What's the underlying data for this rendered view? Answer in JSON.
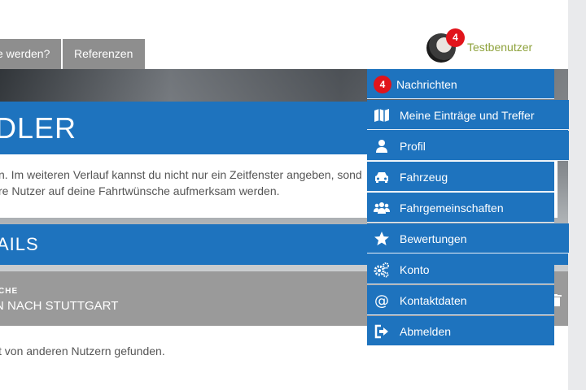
{
  "nav": {
    "tab1_label": "e werden?",
    "tab2_label": "Referenzen"
  },
  "user": {
    "badge_count": "4",
    "name": "Testbenutzer"
  },
  "hero": {
    "title": "DLER",
    "intro_line1": "n. Im weiteren Verlauf kannst du nicht nur ein Zeitfenster angeben, sond",
    "intro_line2": "re Nutzer auf deine Fahrtwünsche aufmerksam werden.",
    "details_title": "AILS",
    "search_label": "CHE",
    "route": "N NACH STUTTGART",
    "found_text": "t von anderen Nutzern gefunden."
  },
  "menu": {
    "messages_count": "4",
    "items": [
      {
        "label": "Nachrichten",
        "icon": "envelope-badge"
      },
      {
        "label": "Meine Einträge und Treffer",
        "icon": "map-icon"
      },
      {
        "label": "Profil",
        "icon": "user-icon"
      },
      {
        "label": "Fahrzeug",
        "icon": "car-icon"
      },
      {
        "label": "Fahrgemeinschaften",
        "icon": "group-icon"
      },
      {
        "label": "Bewertungen",
        "icon": "star-icon"
      },
      {
        "label": "Konto",
        "icon": "gears-icon"
      },
      {
        "label": "Kontaktdaten",
        "icon": "at-icon"
      },
      {
        "label": "Abmelden",
        "icon": "logout-icon"
      }
    ]
  },
  "colors": {
    "brand_blue": "#1e73be",
    "badge_red": "#e1141b",
    "username_green": "#8ea23c",
    "tab_gray": "#8e8e8e"
  }
}
